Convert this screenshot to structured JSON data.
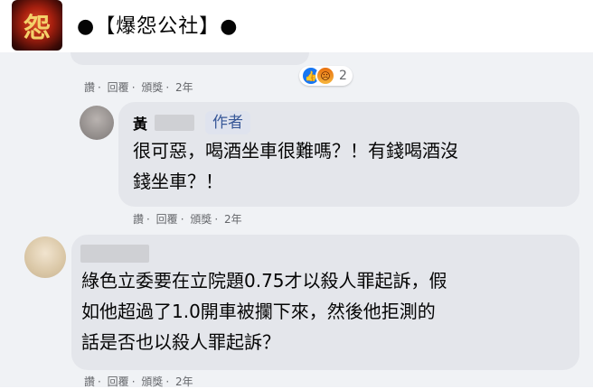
{
  "header": {
    "page_name": "●【爆怨公社】●",
    "avatar_icon": "page-logo"
  },
  "comment_1": {
    "actions": [
      "讚",
      "回覆",
      "頒獎"
    ],
    "time": "2年",
    "reactions": {
      "icons": [
        "like-icon",
        "angry-icon"
      ],
      "count": "2"
    }
  },
  "reply": {
    "author_visible": "黃",
    "author_badge": "作者",
    "text_lines": [
      "很可惡，喝酒坐車很難嗎？！有錢喝酒沒",
      "錢坐車？！"
    ],
    "actions": [
      "讚",
      "回覆",
      "頒獎"
    ],
    "time": "2年"
  },
  "comment_2": {
    "text_lines": [
      "綠色立委要在立院題0.75才以殺人罪起訴，假",
      "如他超過了1.0開車被攔下來，然後他拒測的",
      "話是否也以殺人罪起訴？"
    ],
    "actions": [
      "讚",
      "回覆",
      "頒獎"
    ],
    "time": "2年"
  },
  "colors": {
    "bubble_bg": "#e4e6eb",
    "content_bg": "#f0f2f5",
    "meta_text": "#65676b",
    "badge_text": "#385898"
  }
}
